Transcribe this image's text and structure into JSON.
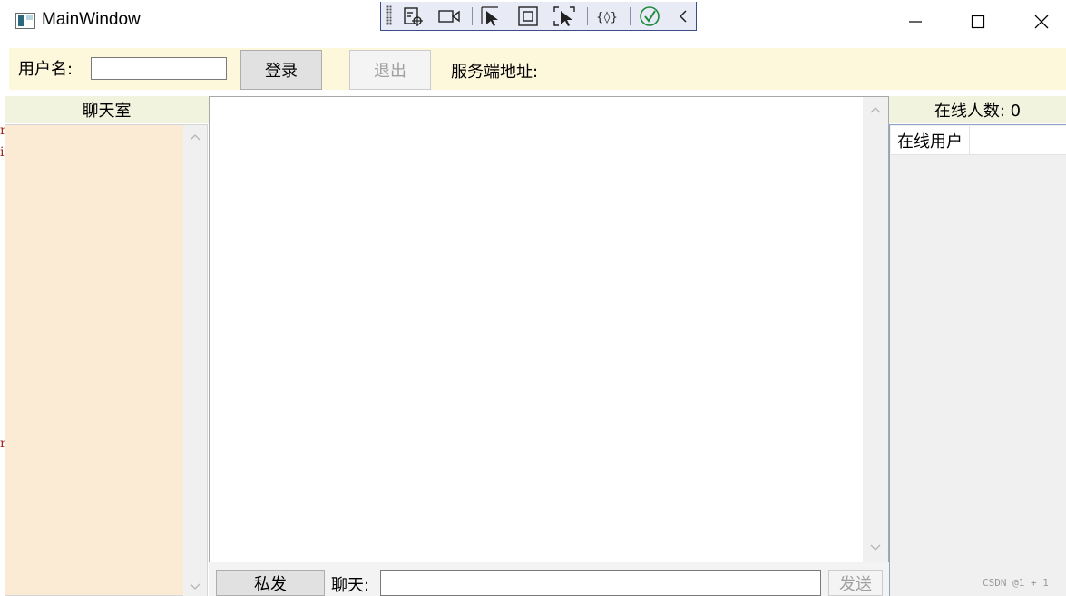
{
  "window": {
    "title": "MainWindow"
  },
  "login_bar": {
    "username_label": "用户名:",
    "username_value": "",
    "login_button": "登录",
    "logout_button": "退出",
    "server_label": "服务端地址:"
  },
  "left_panel": {
    "header": "聊天室"
  },
  "right_panel": {
    "online_count_label": "在线人数: 0",
    "column_header": "在线用户"
  },
  "bottom_bar": {
    "private_button": "私发",
    "chat_label": "聊天:",
    "chat_value": "",
    "send_button": "发送"
  },
  "watermark": "CSDN @1 + 1",
  "colors": {
    "login_strip": "#fdf7dc",
    "panel_header": "#f1f3de",
    "room_list_bg": "#fbebd5",
    "toolbar_border": "#3c4c86"
  }
}
